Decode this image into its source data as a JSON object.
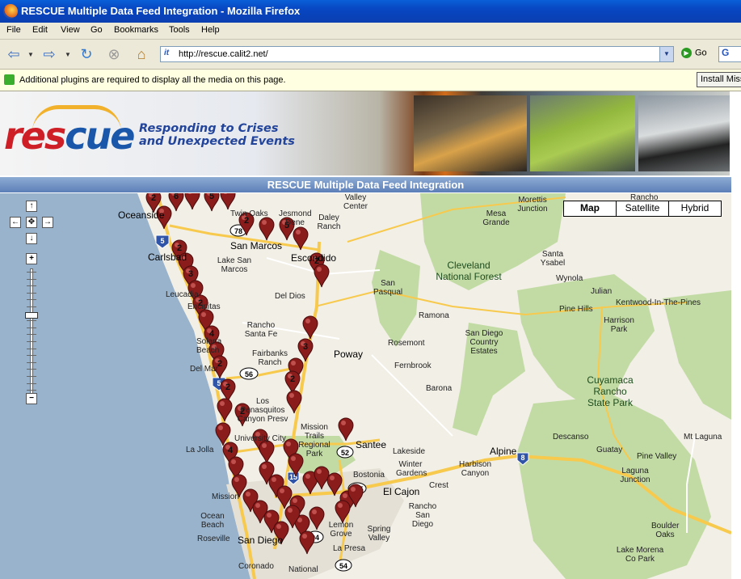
{
  "window": {
    "title": "RESCUE Multiple Data Feed Integration - Mozilla Firefox"
  },
  "menu": [
    "File",
    "Edit",
    "View",
    "Go",
    "Bookmarks",
    "Tools",
    "Help"
  ],
  "toolbar": {
    "url": "http://rescue.calit2.net/",
    "go_label": "Go",
    "site_icon_text": "it",
    "search_glyph": "G"
  },
  "plugin_bar": {
    "message": "Additional plugins are required to display all the media on this page.",
    "install_label": "Install Missing Plugins..."
  },
  "banner": {
    "logo_text_red": "res",
    "logo_text_blue": "cue",
    "tagline_line1": "Responding to Crises",
    "tagline_line2": "and Unexpected Events"
  },
  "map_header": "RESCUE Multiple Data Feed Integration",
  "map_types": [
    "Map",
    "Satellite",
    "Hybrid"
  ],
  "map_controls": {
    "pan_up": "↑",
    "pan_down": "↓",
    "pan_left": "←",
    "pan_right": "→",
    "center": "✥",
    "zoom_in": "+",
    "zoom_out": "−",
    "zoom_level": 0.36
  },
  "place_labels": [
    "Oceanside",
    "Carlsbad",
    "San Marcos",
    "Escondido",
    "Lake San Marcos",
    "Leucadia",
    "Encinitas",
    "Solana Beach",
    "Del Mar",
    "Rancho Santa Fe",
    "Fairbanks Ranch",
    "Del Dios",
    "Poway",
    "Rosemont",
    "Fernbrook",
    "Barona",
    "Ramona",
    "San Pasqual",
    "Valley Center",
    "Daley Ranch",
    "Jesmond Dene",
    "Twin Oaks",
    "Mesa Grande",
    "Morettis Junction",
    "Rancho",
    "Cleveland National Forest",
    "Santa Ysabel",
    "Wynola",
    "Julian",
    "Kentwood-In-The-Pines",
    "Pine Hills",
    "Harrison Park",
    "San Diego Country Estates",
    "Cuyamaca Rancho State Park",
    "Descanso",
    "Guatay",
    "Pine Valley",
    "Mt Laguna",
    "Laguna Junction",
    "Alpine",
    "Harbison Canyon",
    "Crest",
    "El Cajon",
    "Santee",
    "Lakeside",
    "Winter Gardens",
    "Bostonia",
    "Rancho San Diego",
    "Spring Valley",
    "Lemon Grove",
    "La Presa",
    "La Jolla",
    "Mission",
    "Ocean Beach",
    "Roseville",
    "San Diego",
    "Coronado",
    "National",
    "Boulder Oaks",
    "Lake Morena Co Park",
    "Los Penasquitos Canyon Presv",
    "Mission Trails Regional Park",
    "University City"
  ],
  "route_shields": [
    "5",
    "78",
    "56",
    "52",
    "125",
    "94",
    "54",
    "8",
    "15"
  ],
  "marker_labels": [
    "2",
    "2",
    "6",
    "3",
    "5",
    "2",
    "2",
    "3",
    "5",
    "2",
    "2",
    "2",
    "2",
    "2",
    "3",
    "2",
    "2",
    "2",
    "4",
    "2",
    "2",
    "2",
    "3",
    "4",
    "2",
    "4",
    "2",
    "2",
    "2",
    "1",
    "4"
  ]
}
